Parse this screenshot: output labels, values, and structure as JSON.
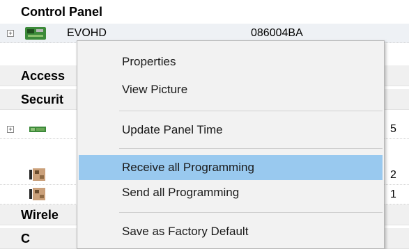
{
  "tree": {
    "header": "Control Panel",
    "panel_row": {
      "name": "EVOHD",
      "serial": "086004BA"
    },
    "sections": {
      "access": "Access",
      "security": "Securit",
      "wireless": "Wirele",
      "last": "C"
    },
    "device_rows": [
      {
        "num": "5",
        "icon": "keypad-icon"
      },
      {
        "num": "2",
        "icon": "module-icon"
      },
      {
        "num": "1",
        "icon": "module-icon"
      }
    ]
  },
  "context_menu": {
    "items": [
      {
        "label": "Properties"
      },
      {
        "label": "View Picture"
      },
      {
        "label": "Update Panel Time"
      },
      {
        "label": "Receive all Programming",
        "highlighted": true
      },
      {
        "label": "Send all Programming"
      },
      {
        "label": "Save as Factory Default"
      }
    ]
  },
  "colors": {
    "menu_highlight": "#99c9ef",
    "menu_background": "#f2f2f2",
    "section_background": "#f0f0f0"
  }
}
